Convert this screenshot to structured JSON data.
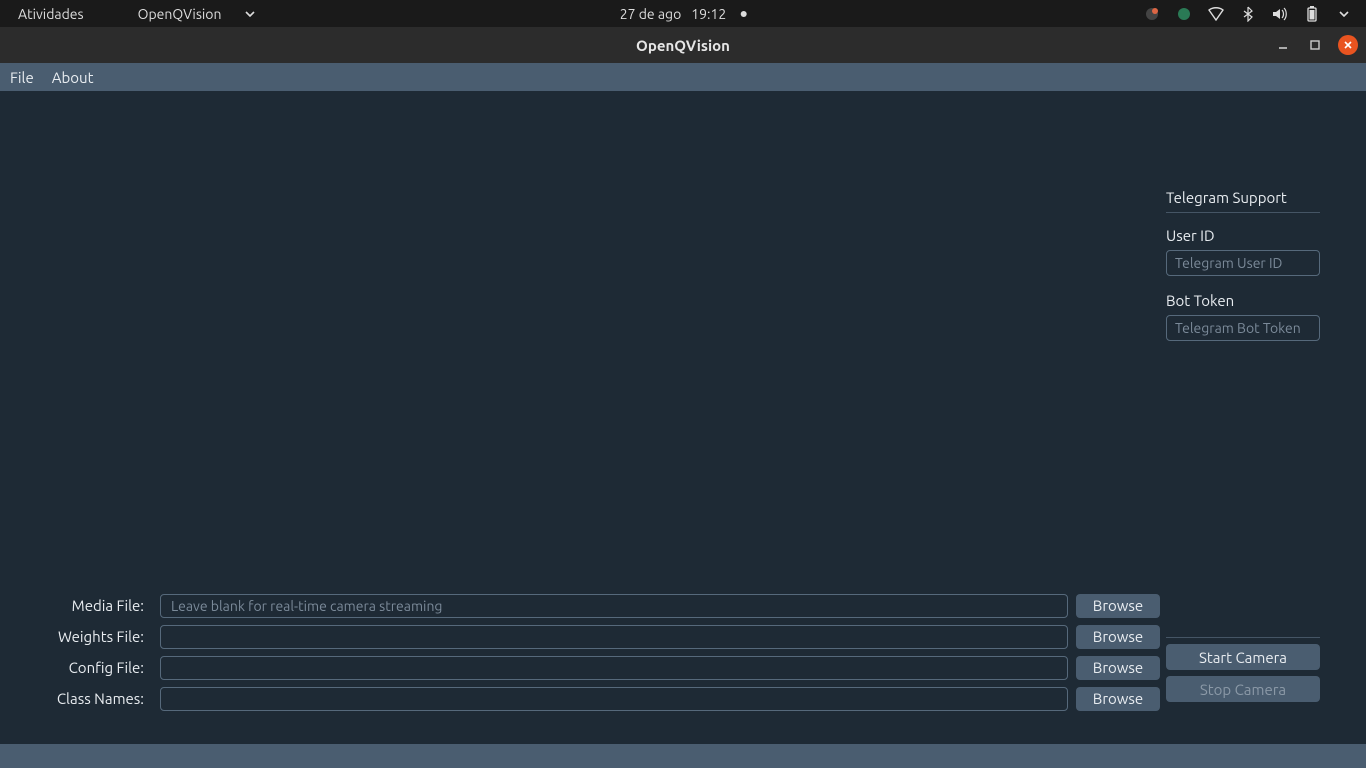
{
  "topbar": {
    "activities": "Atividades",
    "app_menu": "OpenQVision",
    "clock_date": "27 de ago",
    "clock_time": "19:12"
  },
  "window": {
    "title": "OpenQVision"
  },
  "menubar": {
    "file": "File",
    "about": "About"
  },
  "telegram": {
    "heading": "Telegram Support",
    "user_id_label": "User ID",
    "user_id_placeholder": "Telegram User ID",
    "user_id_value": "",
    "bot_token_label": "Bot Token",
    "bot_token_placeholder": "Telegram Bot Token",
    "bot_token_value": ""
  },
  "camera": {
    "start_label": "Start Camera",
    "stop_label": "Stop Camera"
  },
  "files": {
    "media": {
      "label": "Media File:",
      "value": "",
      "placeholder": "Leave blank for real-time camera streaming",
      "browse": "Browse"
    },
    "weights": {
      "label": "Weights File:",
      "value": "",
      "placeholder": "",
      "browse": "Browse"
    },
    "config": {
      "label": "Config File:",
      "value": "",
      "placeholder": "",
      "browse": "Browse"
    },
    "classes": {
      "label": "Class Names:",
      "value": "",
      "placeholder": "",
      "browse": "Browse"
    }
  }
}
